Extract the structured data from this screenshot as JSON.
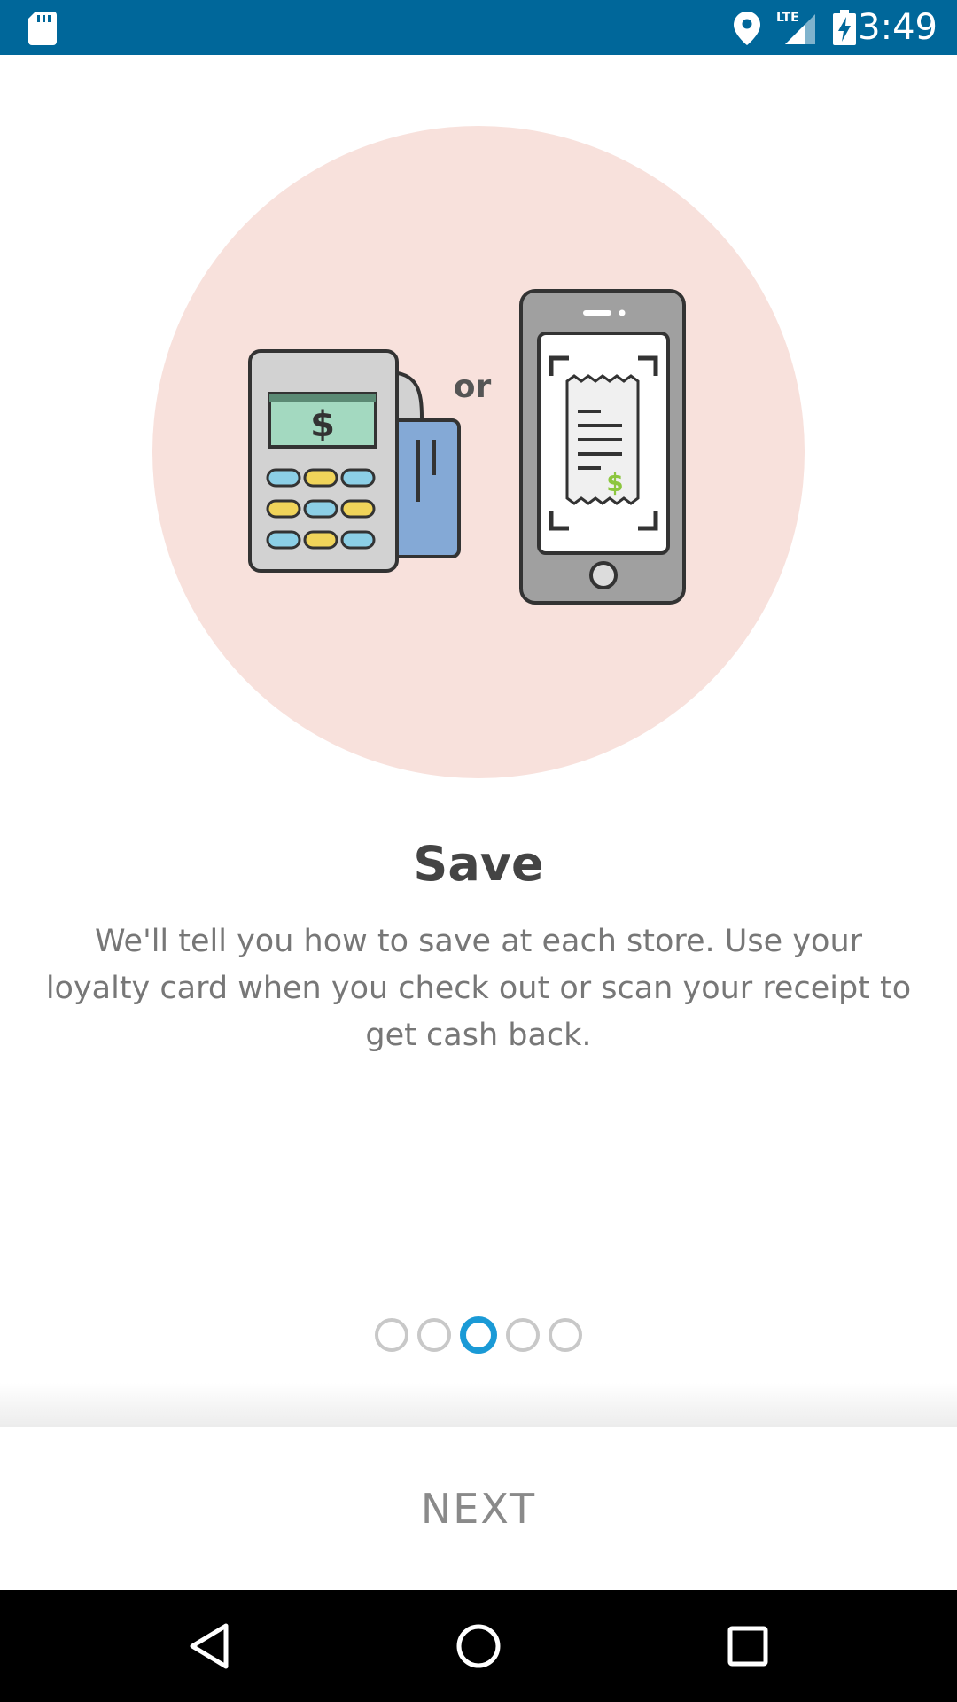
{
  "status_bar": {
    "time": "3:49",
    "network": "LTE",
    "icons": [
      "sd-card-icon",
      "location-icon",
      "lte-signal-icon",
      "battery-charging-icon"
    ]
  },
  "illustration": {
    "connector_text": "or",
    "terminal_screen_symbol": "$",
    "receipt_symbol": "$"
  },
  "content": {
    "title": "Save",
    "description": "We'll tell you how to save at each store. Use your loyalty card when you check out or scan your receipt to get cash back."
  },
  "pager": {
    "total": 5,
    "active_index": 2
  },
  "actions": {
    "next_label": "NEXT"
  },
  "nav_bar": {
    "icons": [
      "back-icon",
      "home-icon",
      "recents-icon"
    ]
  },
  "colors": {
    "status_bar": "#00679a",
    "accent": "#1a9ad6",
    "hero_circle": "#f8e1dc",
    "title": "#444444",
    "body_text": "#777777"
  }
}
